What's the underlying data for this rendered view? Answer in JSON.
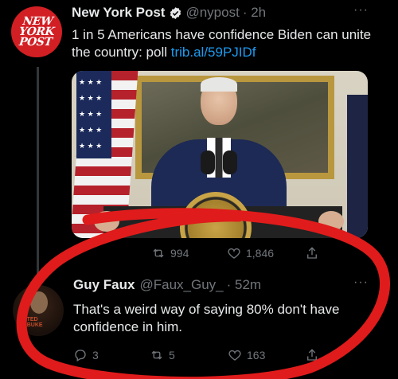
{
  "tweet": {
    "avatar_text": "NEW\nYORK\nPOST",
    "name": "New York Post",
    "handle": "@nypost",
    "time": "· 2h",
    "text": "1 in 5 Americans have confidence Biden can unite the country: poll ",
    "link": "trib.al/59PJIDf",
    "more": "···",
    "actions": {
      "retweets": "994",
      "likes": "1,846"
    }
  },
  "reply": {
    "avatar_caption": "BATED\nREBUKE",
    "name": "Guy Faux",
    "handle": "@Faux_Guy_",
    "time": "· 52m",
    "text": "That's a weird way of saying 80% don't have confidence in him.",
    "more": "···",
    "actions": {
      "replies": "3",
      "retweets": "5",
      "likes": "163"
    }
  },
  "colors": {
    "background": "#000000",
    "accent": "#1d9bf0",
    "muted": "#71767b",
    "annotation": "#e01b1b"
  }
}
